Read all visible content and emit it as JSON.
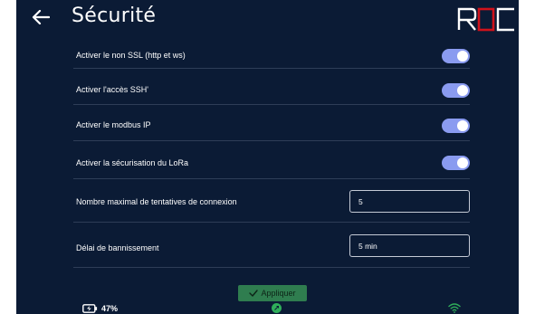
{
  "header": {
    "title": "Sécurité",
    "logo_text": "ROC",
    "logo_color": "#d1121b",
    "back_icon": "arrow-left-icon"
  },
  "settings": [
    {
      "label": "Activer le non SSL (http et ws)",
      "type": "toggle",
      "enabled": true
    },
    {
      "label": "Activer l'accès SSH'",
      "type": "toggle",
      "enabled": true
    },
    {
      "label": "Activer le modbus IP",
      "type": "toggle",
      "enabled": true
    },
    {
      "label": "Activer la sécurisation du LoRa",
      "type": "toggle",
      "enabled": true
    },
    {
      "label": "Nombre maximal de tentatives de connexion",
      "type": "input",
      "value": "5"
    },
    {
      "label": "Délai de bannissement",
      "type": "input",
      "value": "5 min"
    }
  ],
  "apply_button": {
    "label": "Appliquer",
    "icon": "check-icon",
    "color": "#2f7d4f"
  },
  "status_bar": {
    "battery": "47%",
    "battery_icon": "battery-charging-icon",
    "connection_icon": "link-status-icon",
    "wifi_icon": "wifi-icon"
  },
  "colors": {
    "background": "#0b1b35",
    "toggle_on": "#8a9bf0",
    "divider": "#2e3d57",
    "status_green": "#2fae5a"
  }
}
